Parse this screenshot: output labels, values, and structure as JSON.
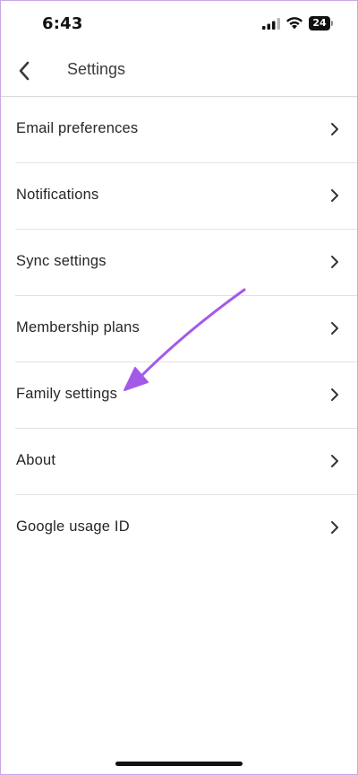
{
  "status_bar": {
    "time": "6:43",
    "battery_level": "24",
    "icons": [
      "signal-icon",
      "wifi-icon",
      "battery-icon"
    ]
  },
  "header": {
    "title": "Settings",
    "back_icon": "chevron-left-icon"
  },
  "settings": {
    "items": [
      {
        "label": "Email preferences",
        "icon": "chevron-right-icon"
      },
      {
        "label": "Notifications",
        "icon": "chevron-right-icon"
      },
      {
        "label": "Sync settings",
        "icon": "chevron-right-icon"
      },
      {
        "label": "Membership plans",
        "icon": "chevron-right-icon"
      },
      {
        "label": "Family settings",
        "icon": "chevron-right-icon"
      },
      {
        "label": "About",
        "icon": "chevron-right-icon"
      },
      {
        "label": "Google usage ID",
        "icon": "chevron-right-icon"
      }
    ]
  },
  "annotation": {
    "type": "arrow",
    "color": "#a559e8",
    "target": "Family settings"
  },
  "colors": {
    "frame_border": "#c9a8e6",
    "divider": "#e2e2e2",
    "text_primary": "#262626"
  }
}
